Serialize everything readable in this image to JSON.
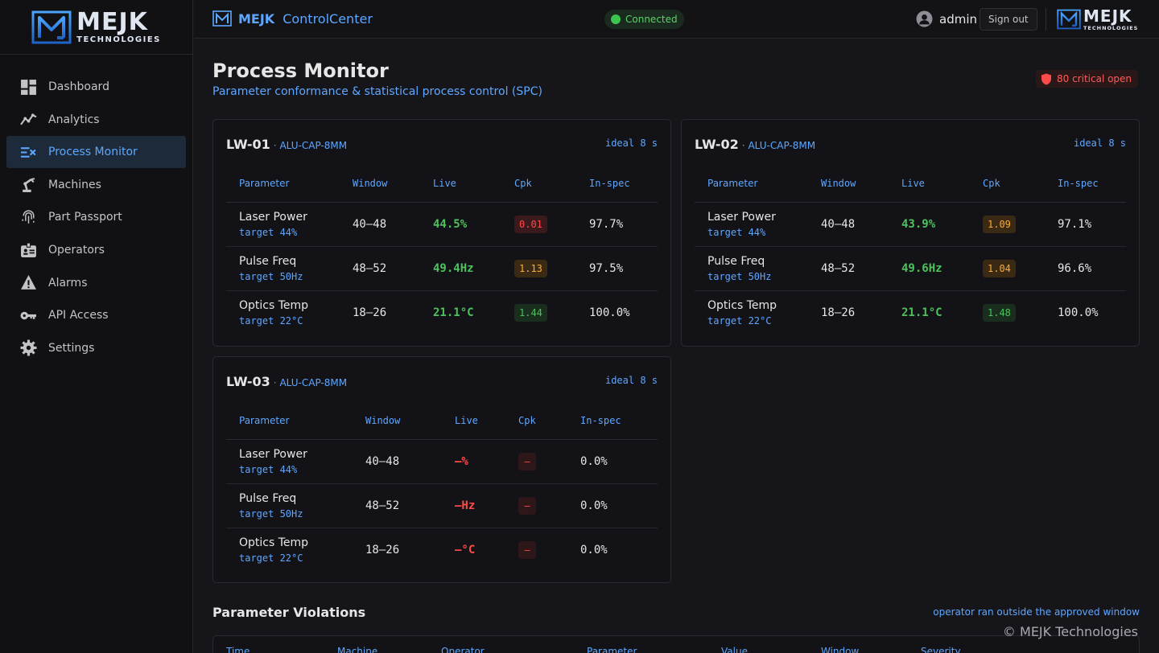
{
  "brand": {
    "big": "MEJK",
    "small": "TECHNOLOGIES"
  },
  "sidebar": {
    "items": [
      {
        "label": "Dashboard",
        "icon": "dashboard-icon",
        "active": false
      },
      {
        "label": "Analytics",
        "icon": "analytics-icon",
        "active": false
      },
      {
        "label": "Process Monitor",
        "icon": "process-monitor-icon",
        "active": true
      },
      {
        "label": "Machines",
        "icon": "robot-arm-icon",
        "active": false
      },
      {
        "label": "Part Passport",
        "icon": "fingerprint-icon",
        "active": false
      },
      {
        "label": "Operators",
        "icon": "id-badge-icon",
        "active": false
      },
      {
        "label": "Alarms",
        "icon": "warning-icon",
        "active": false
      },
      {
        "label": "API Access",
        "icon": "key-icon",
        "active": false
      },
      {
        "label": "Settings",
        "icon": "gear-icon",
        "active": false
      }
    ]
  },
  "header": {
    "brand_bold": "MEJK",
    "brand_text": "ControlCenter",
    "status": "Connected",
    "username": "admin",
    "signout": "Sign out"
  },
  "page": {
    "title": "Process Monitor",
    "subtitle": "Parameter conformance & statistical process control (SPC)",
    "critical": "80 critical open"
  },
  "columns": [
    "Parameter",
    "Window",
    "Live",
    "Cpk",
    "In-spec"
  ],
  "lines": [
    {
      "id": "LW-01",
      "sep": "·",
      "part": "ALU-CAP-8MM",
      "ideal": "ideal 8 s",
      "rows": [
        {
          "name": "Laser Power",
          "target": "target 44%",
          "window": "40–48",
          "live": "44.5%",
          "cpk": "0.01",
          "cpk_level": "red",
          "inspec": "97.7%"
        },
        {
          "name": "Pulse Freq",
          "target": "target 50Hz",
          "window": "48–52",
          "live": "49.4Hz",
          "cpk": "1.13",
          "cpk_level": "orange",
          "inspec": "97.5%"
        },
        {
          "name": "Optics Temp",
          "target": "target 22°C",
          "window": "18–26",
          "live": "21.1°C",
          "cpk": "1.44",
          "cpk_level": "green",
          "inspec": "100.0%"
        }
      ]
    },
    {
      "id": "LW-02",
      "sep": "·",
      "part": "ALU-CAP-8MM",
      "ideal": "ideal 8 s",
      "rows": [
        {
          "name": "Laser Power",
          "target": "target 44%",
          "window": "40–48",
          "live": "43.9%",
          "cpk": "1.09",
          "cpk_level": "orange",
          "inspec": "97.1%"
        },
        {
          "name": "Pulse Freq",
          "target": "target 50Hz",
          "window": "48–52",
          "live": "49.6Hz",
          "cpk": "1.04",
          "cpk_level": "orange",
          "inspec": "96.6%"
        },
        {
          "name": "Optics Temp",
          "target": "target 22°C",
          "window": "18–26",
          "live": "21.1°C",
          "cpk": "1.48",
          "cpk_level": "green",
          "inspec": "100.0%"
        }
      ]
    },
    {
      "id": "LW-03",
      "sep": "·",
      "part": "ALU-CAP-8MM",
      "ideal": "ideal 8 s",
      "rows": [
        {
          "name": "Laser Power",
          "target": "target 44%",
          "window": "40–48",
          "live": "–%",
          "cpk": "–",
          "cpk_level": "dash",
          "inspec": "0.0%"
        },
        {
          "name": "Pulse Freq",
          "target": "target 50Hz",
          "window": "48–52",
          "live": "–Hz",
          "cpk": "–",
          "cpk_level": "dash",
          "inspec": "0.0%"
        },
        {
          "name": "Optics Temp",
          "target": "target 22°C",
          "window": "18–26",
          "live": "–°C",
          "cpk": "–",
          "cpk_level": "dash",
          "inspec": "0.0%"
        }
      ]
    }
  ],
  "violations": {
    "title": "Parameter Violations",
    "note": "operator ran outside the approved window",
    "columns": [
      "Time",
      "Machine",
      "Operator",
      "Parameter",
      "Value",
      "Window",
      "Severity"
    ]
  },
  "copyright": "© MEJK Technologies",
  "colors": {
    "accent": "#5ea7ff",
    "ok": "#4cc25c",
    "warn": "#ffaa33",
    "bad": "#ff4a4a"
  }
}
